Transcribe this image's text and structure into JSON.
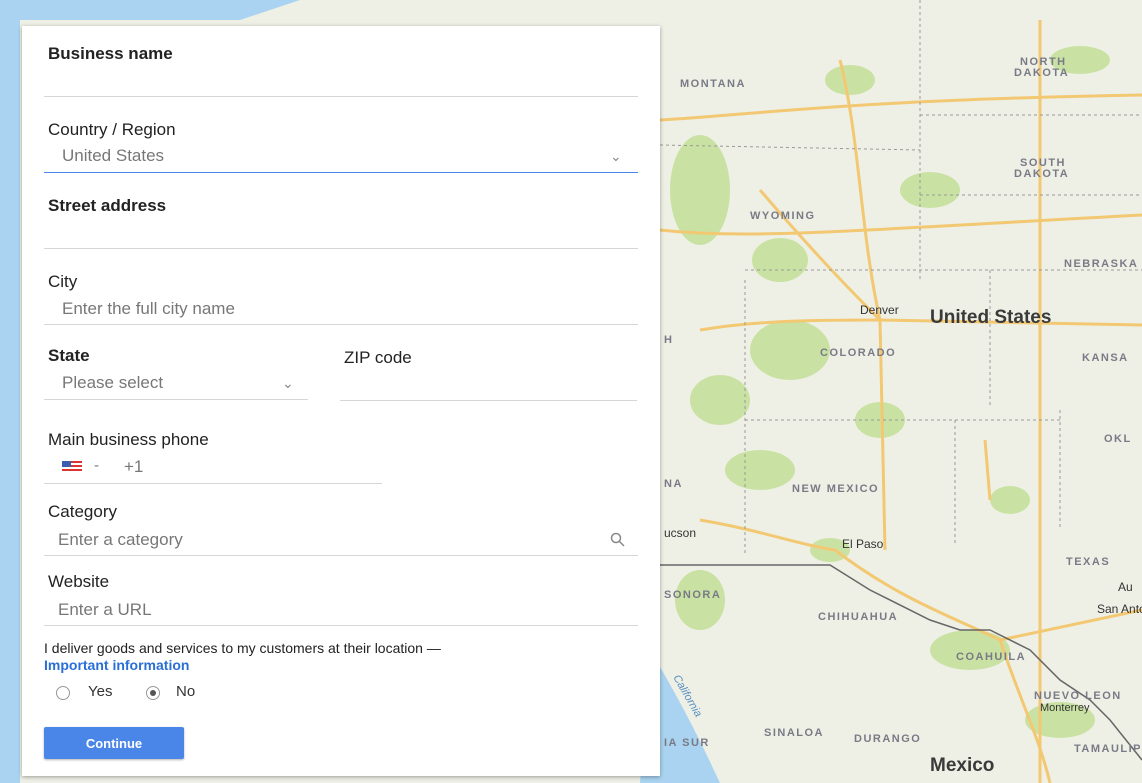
{
  "form": {
    "business_name": {
      "label": "Business name",
      "value": ""
    },
    "country": {
      "label": "Country / Region",
      "value": "United States"
    },
    "street": {
      "label": "Street address",
      "value": ""
    },
    "city": {
      "label": "City",
      "placeholder": "Enter the full city name"
    },
    "state": {
      "label": "State",
      "placeholder": "Please select"
    },
    "zip": {
      "label": "ZIP code",
      "value": ""
    },
    "phone": {
      "label": "Main business phone",
      "flag_icon": "us-flag-icon",
      "dash": "-",
      "prefix": "+1"
    },
    "category": {
      "label": "Category",
      "placeholder": "Enter a category",
      "icon": "search-icon"
    },
    "website": {
      "label": "Website",
      "placeholder": "Enter a URL"
    },
    "delivery": {
      "text": "I deliver goods and services to my customers at their location —",
      "link": "Important information",
      "options": [
        {
          "label": "Yes",
          "selected": false
        },
        {
          "label": "No",
          "selected": true
        }
      ]
    },
    "continue_label": "Continue"
  },
  "map": {
    "country_labels": [
      "United States",
      "Mexico"
    ],
    "state_labels": [
      "MONTANA",
      "NORTH",
      "DAKOTA",
      "SOUTH",
      "DAKOTA",
      "WYOMING",
      "NEBRASKA",
      "COLORADO",
      "KANSA",
      "NEW MEXICO",
      "OKL",
      "TEXAS",
      "SONORA",
      "CHIHUAHUA",
      "COAHUILA",
      "NUEVO LEON",
      "SINALOA",
      "DURANGO",
      "TAMAULIP",
      "IA SUR",
      "NA",
      "H"
    ],
    "city_labels": [
      "Denver",
      "El Paso",
      "ucson",
      "Monterrey",
      "San Anto",
      "Au"
    ],
    "water_label": "California",
    "colors": {
      "land": "#eef0e6",
      "park": "#c9e2a3",
      "road": "#f3c872",
      "water": "#a9d3f0",
      "border": "#999999"
    }
  }
}
